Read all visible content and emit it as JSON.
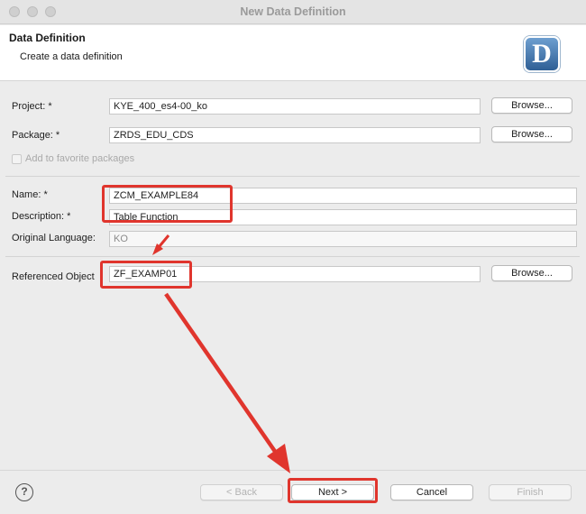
{
  "window": {
    "title": "New Data Definition"
  },
  "header": {
    "title": "Data Definition",
    "subtitle": "Create a data definition",
    "logo_letter": "D"
  },
  "form": {
    "project": {
      "label": "Project: *",
      "value": "KYE_400_es4-00_ko"
    },
    "package": {
      "label": "Package: *",
      "value": "ZRDS_EDU_CDS"
    },
    "favorite": {
      "label": "Add to favorite packages"
    },
    "name": {
      "label": "Name: *",
      "value": "ZCM_EXAMPLE84"
    },
    "description": {
      "label": "Description: *",
      "value": "Table Function"
    },
    "language": {
      "label": "Original Language:",
      "value": "KO"
    },
    "referenced": {
      "label": "Referenced Object",
      "value": "ZF_EXAMP01"
    },
    "browse_label": "Browse..."
  },
  "footer": {
    "help_glyph": "?",
    "back": "< Back",
    "next": "Next >",
    "cancel": "Cancel",
    "finish": "Finish"
  },
  "colors": {
    "annotation": "#e0352d",
    "logo": "#3d6ea6"
  }
}
